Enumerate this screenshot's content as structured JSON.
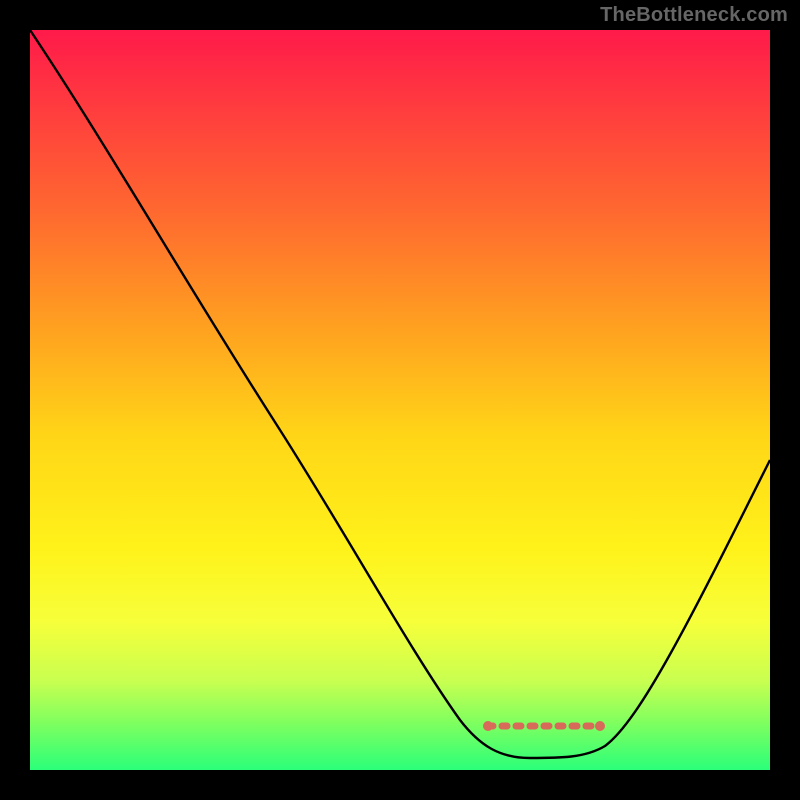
{
  "watermark": "TheBottleneck.com",
  "chart_data": {
    "type": "line",
    "title": "",
    "xlabel": "",
    "ylabel": "",
    "xlim": [
      0,
      100
    ],
    "ylim": [
      0,
      100
    ],
    "series": [
      {
        "name": "curve",
        "x": [
          0,
          5,
          10,
          20,
          30,
          40,
          50,
          57,
          60,
          64,
          68,
          72,
          75,
          78,
          82,
          88,
          94,
          100
        ],
        "values": [
          100,
          93,
          86,
          72,
          58,
          44,
          30,
          18,
          11,
          5,
          2,
          2,
          2,
          2,
          5,
          15,
          28,
          42
        ]
      },
      {
        "name": "flat-marker",
        "x": [
          62,
          77
        ],
        "values": [
          6,
          6
        ]
      }
    ],
    "gradient_stops": [
      {
        "pos": 0,
        "color": "#ff1a4a"
      },
      {
        "pos": 10,
        "color": "#ff3a3f"
      },
      {
        "pos": 25,
        "color": "#ff6a2f"
      },
      {
        "pos": 40,
        "color": "#ffa020"
      },
      {
        "pos": 55,
        "color": "#ffd617"
      },
      {
        "pos": 70,
        "color": "#fff21a"
      },
      {
        "pos": 80,
        "color": "#f6ff3a"
      },
      {
        "pos": 88,
        "color": "#c8ff50"
      },
      {
        "pos": 94,
        "color": "#7aff60"
      },
      {
        "pos": 100,
        "color": "#2bff7a"
      }
    ],
    "colors": {
      "background": "#000000",
      "curve": "#000000",
      "marker": "#d86a5a"
    }
  }
}
